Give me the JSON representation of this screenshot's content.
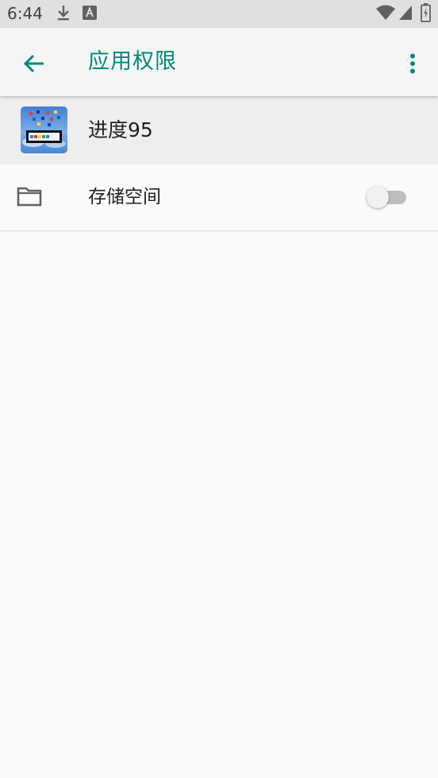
{
  "status_bar": {
    "time": "6:44",
    "icons": [
      "download-icon",
      "text-a-icon",
      "wifi-icon",
      "signal-icon",
      "battery-icon"
    ]
  },
  "app_bar": {
    "title": "应用权限",
    "back_icon": "arrow-left-icon",
    "overflow_icon": "more-vertical-icon",
    "accent_color": "#00897b"
  },
  "app_header": {
    "name": "进度95",
    "icon": "app-icon"
  },
  "permissions": [
    {
      "label": "存储空间",
      "icon": "folder-icon",
      "enabled": false
    }
  ]
}
